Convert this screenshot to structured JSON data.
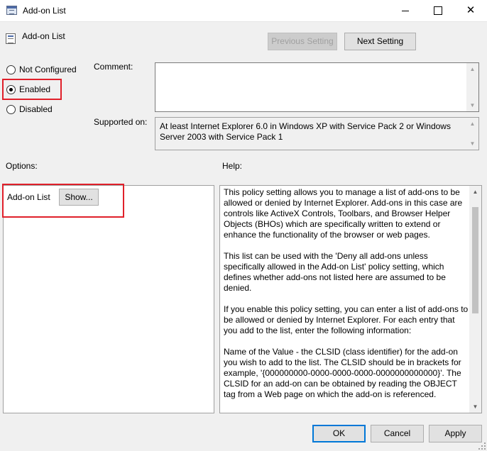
{
  "window": {
    "title": "Add-on List"
  },
  "header": {
    "policy_name": "Add-on List",
    "previous_label": "Previous Setting",
    "next_label": "Next Setting"
  },
  "state": {
    "options": [
      {
        "label": "Not Configured",
        "checked": false
      },
      {
        "label": "Enabled",
        "checked": true
      },
      {
        "label": "Disabled",
        "checked": false
      }
    ]
  },
  "comment": {
    "label": "Comment:",
    "value": ""
  },
  "supported": {
    "label": "Supported on:",
    "value": "At least Internet Explorer 6.0 in Windows XP with Service Pack 2 or Windows Server 2003 with Service Pack 1"
  },
  "options_section": {
    "label": "Options:",
    "addon_label": "Add-on List",
    "show_label": "Show..."
  },
  "help_section": {
    "label": "Help:",
    "paragraphs": [
      "This policy setting allows you to manage a list of add-ons to be allowed or denied by Internet Explorer. Add-ons in this case are controls like ActiveX Controls, Toolbars, and Browser Helper Objects (BHOs) which are specifically written to extend or enhance the functionality of the browser or web pages.",
      "This list can be used with the 'Deny all add-ons unless specifically allowed in the Add-on List' policy setting, which defines whether add-ons not listed here are assumed to be denied.",
      "If you enable this policy setting, you can enter a list of add-ons to be allowed or denied by Internet Explorer. For each entry that you add to the list, enter the following information:",
      "Name of the Value - the CLSID (class identifier) for the add-on you wish to add to the list.  The CLSID should be in brackets for example, '{000000000-0000-0000-0000-0000000000000}'. The CLSID for an add-on can be obtained by reading the OBJECT tag from a Web page on which the add-on is referenced."
    ]
  },
  "footer": {
    "ok_label": "OK",
    "cancel_label": "Cancel",
    "apply_label": "Apply"
  },
  "colors": {
    "highlight": "#e0202a",
    "focus": "#0078d7"
  }
}
